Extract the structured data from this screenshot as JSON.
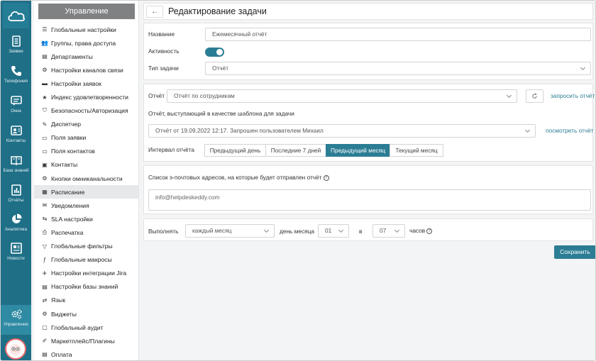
{
  "rail": {
    "items": [
      {
        "label": "Заявки",
        "icon": "tickets-icon"
      },
      {
        "label": "Телефония",
        "icon": "phone-icon"
      },
      {
        "label": "Окна",
        "icon": "chat-icon"
      },
      {
        "label": "Контакты",
        "icon": "contacts-icon"
      },
      {
        "label": "База знаний",
        "icon": "book-icon"
      },
      {
        "label": "Отчёты",
        "icon": "report-icon"
      },
      {
        "label": "Аналитика",
        "icon": "pie-chart-icon"
      },
      {
        "label": "Новости",
        "icon": "news-icon"
      },
      {
        "label": "Управление",
        "icon": "gears-icon"
      }
    ]
  },
  "menu": {
    "title": "Управление",
    "items": [
      "Глобальные настройки",
      "Группы, права доступа",
      "Департаменты",
      "Настройки каналов связи",
      "Настройки заявок",
      "Индекс удовлетворенности",
      "Безопасность/Авторизация",
      "Диспетчер",
      "Поля заявки",
      "Поля контактов",
      "Контакты",
      "Кнопки омниканальности",
      "Расписание",
      "Уведомления",
      "SLA настройки",
      "Распечатка",
      "Глобальные фильтры",
      "Глобальные макросы",
      "Настройки интеграции Jira",
      "Настройки базы знаний",
      "Язык",
      "Виджеты",
      "Глобальный аудит",
      "Маркетплейс/Плагины",
      "Оплата"
    ],
    "active_index": 12
  },
  "header": {
    "back": "←",
    "title": "Редактирование задачи"
  },
  "task": {
    "name_label": "Название",
    "name_value": "Ежемесячный отчёт",
    "active_label": "Активность",
    "type_label": "Тип задачи",
    "type_value": "Отчёт"
  },
  "report": {
    "report_label": "Отчёт",
    "report_value": "Отчёт по сотрудникам",
    "request_link": "запросить отчёт",
    "template_label": "Отчёт, выступающий в качестве шаблона для задачи",
    "template_value": "Отчёт от 19.09.2022 12:17. Запрошен пользователем Михаил",
    "view_link": "посмотреть отчёт",
    "interval_label": "Интервал отчёта",
    "intervals": [
      "Предыдущий день",
      "Последние 7 дней",
      "Предыдущий месяц",
      "Текущий месяц"
    ],
    "active_interval": 2
  },
  "emails": {
    "label": "Список э-почтовых адресов, на которые будет отправлен отчёт",
    "help": "?",
    "value": "info@helpdeskeddy.com"
  },
  "schedule": {
    "run_label": "Выполнять",
    "frequency": "каждый месяц",
    "day_label": "день месяца",
    "day_value": "01",
    "at_label": "в",
    "hour_value": "07",
    "hours_label": "часов",
    "help": "?"
  },
  "actions": {
    "save": "Сохранить"
  },
  "colors": {
    "rail": "#1f6f87",
    "accent": "#2b7d94",
    "menu_header": "#7f8183"
  }
}
